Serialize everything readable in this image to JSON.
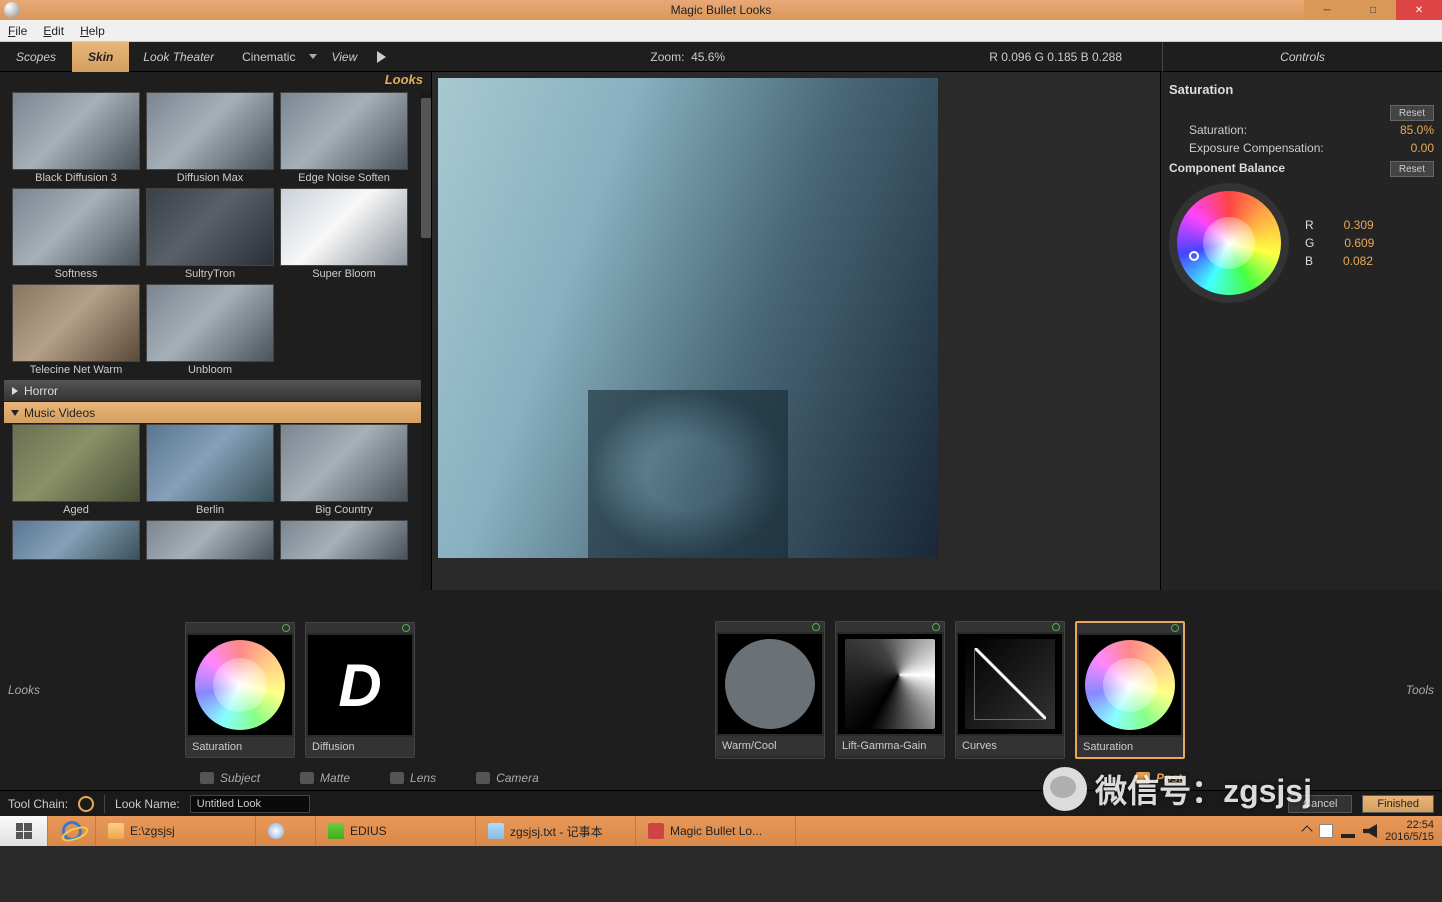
{
  "window": {
    "title": "Magic Bullet Looks"
  },
  "menubar": {
    "file": "File",
    "edit": "Edit",
    "help": "Help"
  },
  "toolbar": {
    "scopes": "Scopes",
    "skin": "Skin",
    "look_theater": "Look Theater",
    "category": "Cinematic",
    "view": "View",
    "zoom_label": "Zoom:",
    "zoom_value": "45.6%",
    "rgb": "R  0.096    G  0.185    B  0.288",
    "controls": "Controls"
  },
  "looks": {
    "header": "Looks",
    "row1": [
      "Black Diffusion 3",
      "Diffusion Max",
      "Edge Noise Soften"
    ],
    "row2": [
      "Softness",
      "SultryTron",
      "Super Bloom"
    ],
    "row3": [
      "Telecine Net Warm",
      "Unbloom",
      ""
    ],
    "cat_horror": "Horror",
    "cat_music": "Music Videos",
    "row4": [
      "Aged",
      "Berlin",
      "Big Country"
    ]
  },
  "controls": {
    "title": "Saturation",
    "reset": "Reset",
    "sat_label": "Saturation:",
    "sat_value": "85.0%",
    "exp_label": "Exposure Compensation:",
    "exp_value": "0.00",
    "balance": "Component Balance",
    "r_label": "R",
    "r_val": "0.309",
    "g_label": "G",
    "g_val": "0.609",
    "b_label": "B",
    "b_val": "0.082"
  },
  "chain": {
    "looks_label": "Looks",
    "tools_label": "Tools",
    "items_left": [
      "Saturation",
      "Diffusion"
    ],
    "items_right": [
      "Warm/Cool",
      "Lift-Gamma-Gain",
      "Curves",
      "Saturation"
    ]
  },
  "stages": {
    "subject": "Subject",
    "matte": "Matte",
    "lens": "Lens",
    "camera": "Camera",
    "post": "Post"
  },
  "bottombar": {
    "toolchain": "Tool Chain:",
    "lookname_label": "Look Name:",
    "lookname_value": "Untitled Look",
    "cancel": "Cancel",
    "finished": "Finished"
  },
  "watermark": "微信号：zgsjsj",
  "taskbar": {
    "explorer": "E:\\zgsjsj",
    "edius": "EDIUS",
    "notepad": "zgsjsj.txt - 记事本",
    "mbl": "Magic Bullet Lo...",
    "time": "22:54",
    "date": "2016/5/15"
  }
}
